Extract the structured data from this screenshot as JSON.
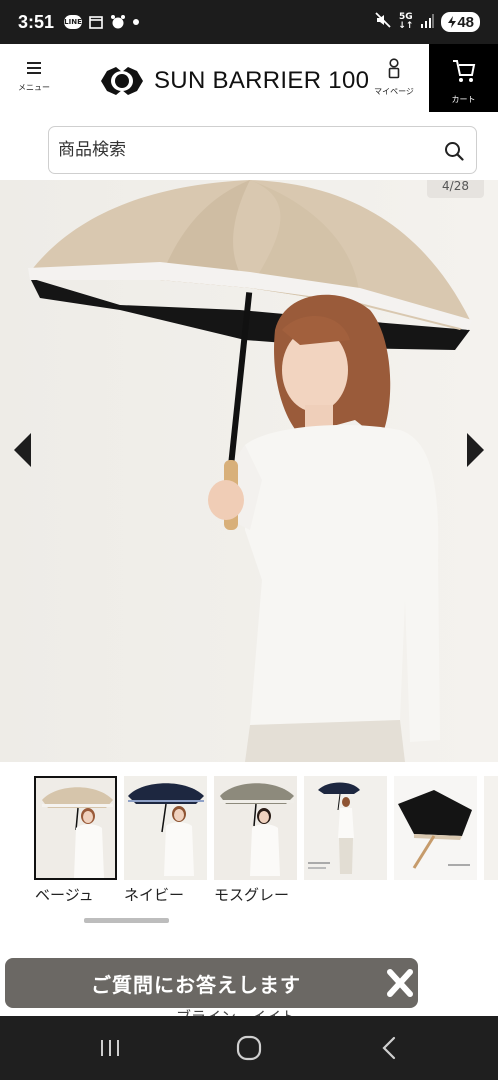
{
  "status_bar": {
    "time": "3:51",
    "icons_left": [
      "line-icon",
      "calendar-icon",
      "alarm-icon",
      "notification-dot-icon"
    ],
    "line_text": "LINE",
    "network_top": "5G",
    "network_bottom": "↓↑",
    "battery": "48"
  },
  "header": {
    "menu_label": "メニュー",
    "brand": "SUN BARRIER 100",
    "mypage_label": "マイページ",
    "cart_label": "カート"
  },
  "search": {
    "placeholder": "商品検索"
  },
  "gallery": {
    "counter": "4/28"
  },
  "color_options": [
    {
      "label": "ベージュ",
      "selected": true
    },
    {
      "label": "ネイビー",
      "selected": false
    },
    {
      "label": "モスグレー",
      "selected": false
    }
  ],
  "faq_banner": {
    "text": "ご質問にお答えします",
    "behind_text": "ブライン　イイト"
  },
  "colors": {
    "header_bg": "#ffffff",
    "cart_bg": "#000000",
    "banner_bg": "#6b6864",
    "nav_bg": "#1f1f1f",
    "canopy_beige": "#d9c8b0"
  }
}
